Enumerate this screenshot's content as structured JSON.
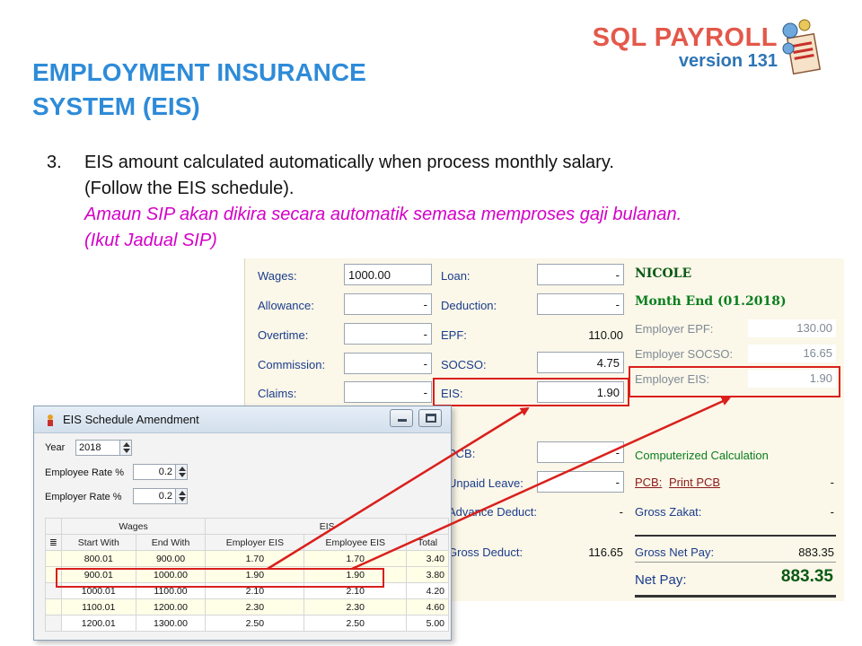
{
  "header": {
    "brand_title": "SQL PAYROLL",
    "brand_version": "version 131",
    "logo_icon": "payroll-document-icon",
    "slide_title_line1": "EMPLOYMENT INSURANCE",
    "slide_title_line2": "SYSTEM (EIS)"
  },
  "point": {
    "number": "3.",
    "line1": "EIS amount calculated automatically when process monthly salary.",
    "line2": "(Follow the EIS schedule).",
    "malay_line1": "Amaun SIP akan dikira secara automatik semasa memproses gaji bulanan.",
    "malay_line2": "(Ikut Jadual SIP)"
  },
  "payroll": {
    "wages_label": "Wages:",
    "wages_value": "1000.00",
    "allowance_label": "Allowance:",
    "allowance_value": "-",
    "overtime_label": "Overtime:",
    "overtime_value": "-",
    "commission_label": "Commission:",
    "commission_value": "-",
    "claims_label": "Claims:",
    "claims_value": "-",
    "loan_label": "Loan:",
    "loan_value": "-",
    "deduction_label": "Deduction:",
    "deduction_value": "-",
    "epf_label": "EPF:",
    "epf_value": "110.00",
    "socso_label": "SOCSO:",
    "socso_value": "4.75",
    "eis_label": "EIS:",
    "eis_value": "1.90",
    "pcb_label": "PCB:",
    "pcb_value": "-",
    "unpaid_leave_label": "Unpaid Leave:",
    "unpaid_leave_value": "-",
    "advance_deduct_label": "Advance Deduct:",
    "advance_deduct_value": "-",
    "gross_deduct_label": "Gross Deduct:",
    "gross_deduct_value": "116.65",
    "employee_name": "NICOLE",
    "period": "Month End (01.2018)",
    "employer_epf_label": "Employer EPF:",
    "employer_epf_value": "130.00",
    "employer_socso_label": "Employer SOCSO:",
    "employer_socso_value": "16.65",
    "employer_eis_label": "Employer EIS:",
    "employer_eis_value": "1.90",
    "computerized_calc": "Computerized Calculation",
    "pcb_link": "PCB:",
    "print_pcb_link": "Print PCB",
    "pcb_right_value": "-",
    "gross_zakat_label": "Gross Zakat:",
    "gross_zakat_value": "-",
    "gross_net_pay_label": "Gross Net Pay:",
    "gross_net_pay_value": "883.35",
    "net_pay_label": "Net Pay:",
    "net_pay_value": "883.35"
  },
  "dialog": {
    "title": "EIS Schedule Amendment",
    "year_label": "Year",
    "year_value": "2018",
    "employee_rate_label": "Employee Rate %",
    "employee_rate_value": "0.2",
    "employer_rate_label": "Employer Rate %",
    "employer_rate_value": "0.2",
    "group_wages": "Wages",
    "group_eis": "EIS",
    "columns": [
      "Start With",
      "End With",
      "Employer EIS",
      "Employee EIS",
      "Total"
    ],
    "rows": [
      [
        "800.01",
        "900.00",
        "1.70",
        "1.70",
        "3.40"
      ],
      [
        "900.01",
        "1000.00",
        "1.90",
        "1.90",
        "3.80"
      ],
      [
        "1000.01",
        "1100.00",
        "2.10",
        "2.10",
        "4.20"
      ],
      [
        "1100.01",
        "1200.00",
        "2.30",
        "2.30",
        "4.60"
      ],
      [
        "1200.01",
        "1300.00",
        "2.50",
        "2.50",
        "5.00"
      ]
    ]
  },
  "colors": {
    "brand_red": "#e3584a",
    "title_blue": "#2e8bd8",
    "malay_magenta": "#d400c8",
    "highlight_red": "#d9201c"
  }
}
